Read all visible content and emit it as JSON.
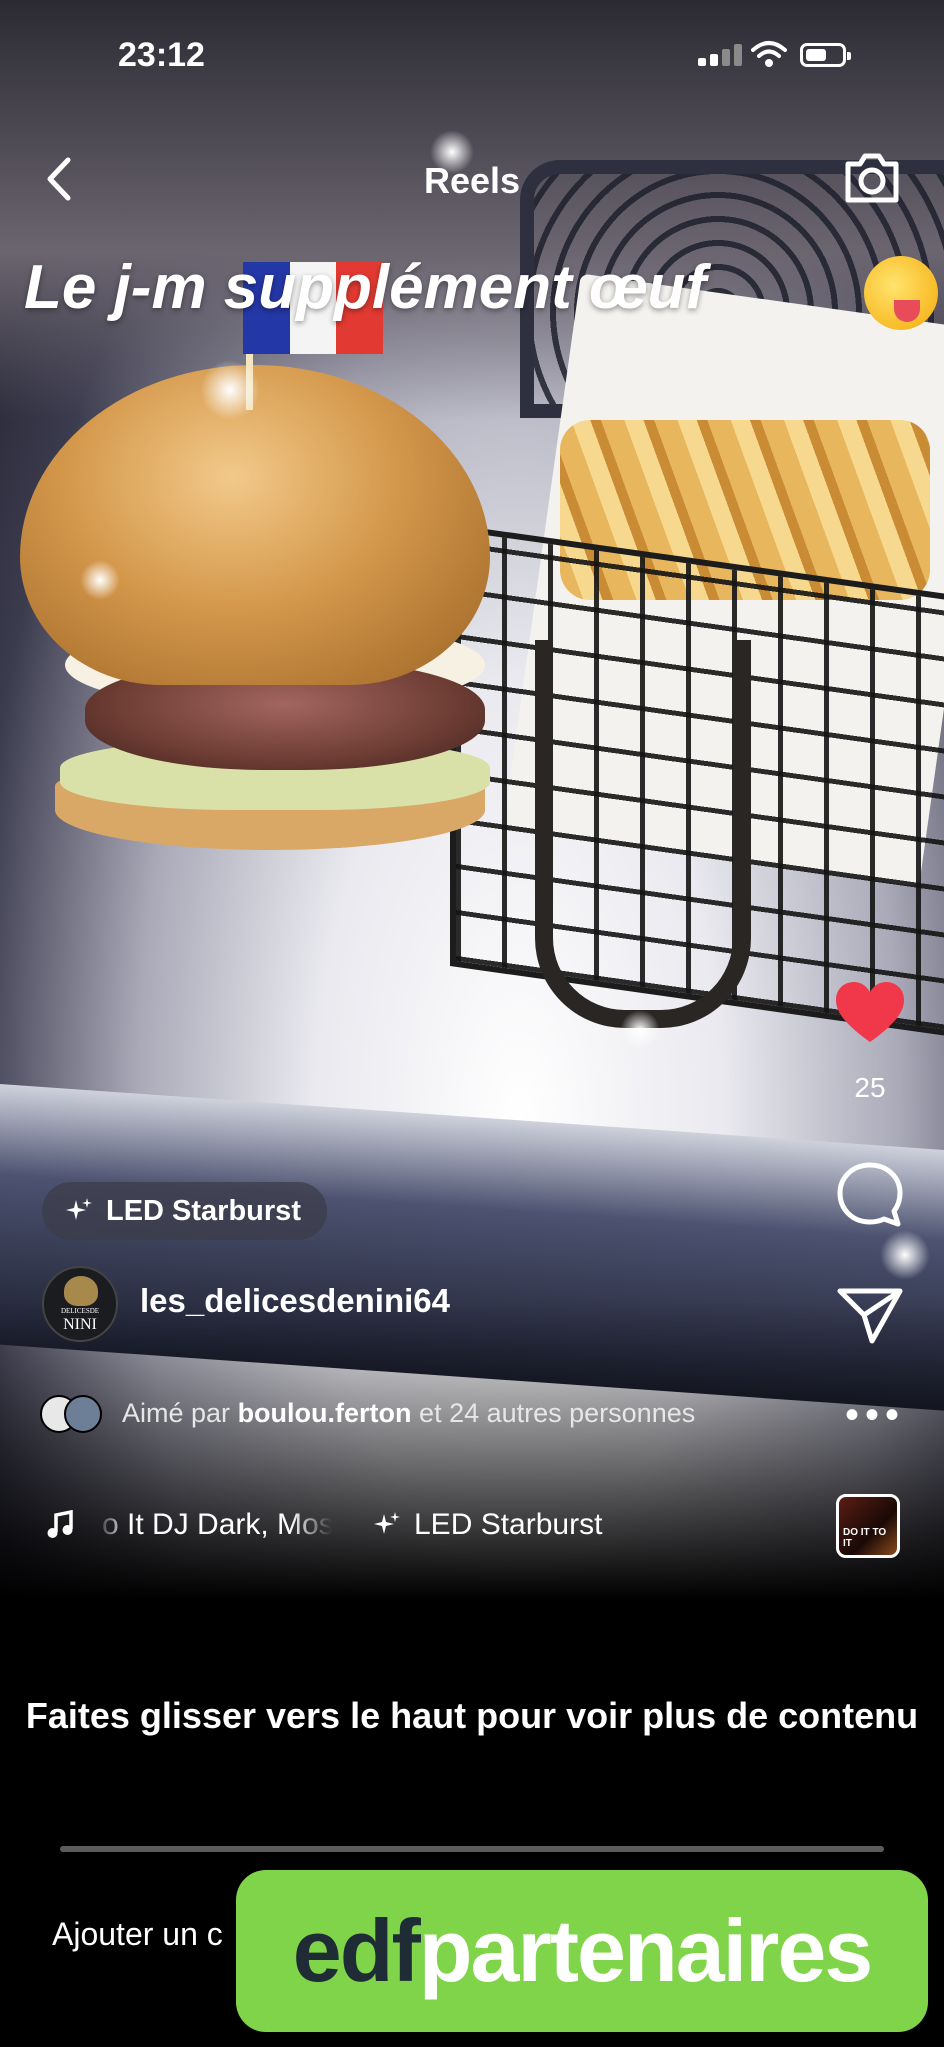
{
  "status_bar": {
    "time": "23:12"
  },
  "header": {
    "title": "Reels"
  },
  "reel": {
    "caption": "Le j-m supplément œuf",
    "effect_chip_label": "LED Starburst",
    "username": "les_delicesdenini64",
    "avatar_text_top": "DELICESDE",
    "avatar_text_bottom": "NINI",
    "likes_count": "25",
    "liked_by_prefix": "Aimé par",
    "liked_by_user": "boulou.ferton",
    "liked_by_suffix": "et 24 autres personnes",
    "audio_track": "o It  DJ Dark, Mos",
    "audio_effect_label": "LED Starburst",
    "audio_thumb_text": "DO IT TO IT"
  },
  "footer": {
    "prompt": "Faites glisser vers le haut pour voir plus de contenu",
    "comment_placeholder": "Ajouter un c"
  },
  "banner": {
    "part1": "edf",
    "part2": "partenaires"
  },
  "colors": {
    "like": "#f0384a",
    "banner_bg": "#7fd44a",
    "banner_text_dark": "#1f2c35"
  },
  "icons": [
    "back-icon",
    "camera-icon",
    "heart-icon",
    "comment-icon",
    "share-icon",
    "more-icon",
    "music-icon",
    "sparkle-icon",
    "wifi-icon",
    "battery-icon",
    "signal-icon"
  ]
}
